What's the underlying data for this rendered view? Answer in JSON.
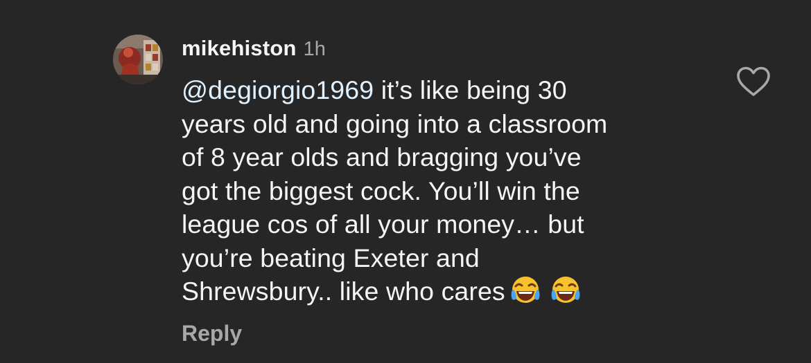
{
  "comment": {
    "username": "mikehiston",
    "timestamp": "1h",
    "mention": "@degiorgio1969",
    "lines": [
      " it’s like being 30",
      "years old and going into a classroom",
      "of 8 year olds and bragging you’ve",
      "got the biggest cock. You’ll win the",
      "league cos of all your money… but",
      "you’re beating Exeter and",
      "Shrewsbury.. like who cares"
    ],
    "emojis": [
      "face-with-tears-of-joy-icon",
      "face-with-tears-of-joy-icon"
    ],
    "reply_label": "Reply",
    "liked": false
  },
  "colors": {
    "background": "#262626",
    "text": "#f5f5f5",
    "secondary": "#a8a8a8",
    "mention": "#e0f1ff"
  }
}
